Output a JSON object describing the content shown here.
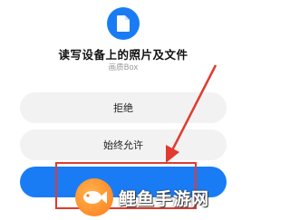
{
  "dialog": {
    "icon": "file-icon",
    "title": "读写设备上的照片及文件",
    "subtitle": "画质Box",
    "buttons": {
      "deny": "拒绝",
      "always_allow": "始终允许",
      "primary": ""
    }
  },
  "annotation": {
    "highlight_color": "#e23a2e"
  },
  "watermark": {
    "text": "鲤鱼手游网"
  },
  "colors": {
    "accent": "#1a7cf5",
    "button_bg": "#f2f2f2"
  }
}
